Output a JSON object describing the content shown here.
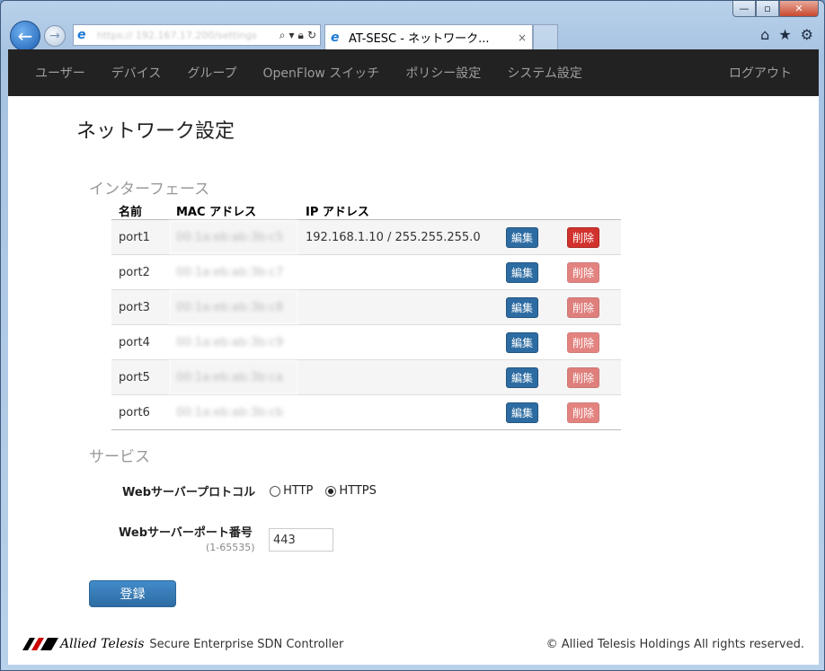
{
  "browser": {
    "address_text": "https://  192.167.17.200/settings",
    "tab_title": "AT-SESC - ネットワーク...",
    "tab_close": "×",
    "window_controls": {
      "minimize": "—",
      "maximize": "▫",
      "close": "✕"
    }
  },
  "navbar": {
    "items": [
      "ユーザー",
      "デバイス",
      "グループ",
      "OpenFlow スイッチ",
      "ポリシー設定",
      "システム設定"
    ],
    "logout": "ログアウト"
  },
  "page": {
    "title": "ネットワーク設定"
  },
  "interfaces": {
    "heading": "インターフェース",
    "columns": {
      "name": "名前",
      "mac": "MAC アドレス",
      "ip": "IP アドレス"
    },
    "edit_label": "編集",
    "delete_label": "削除",
    "rows": [
      {
        "name": "port1",
        "mac": "00:1a:eb:ab:3b:c5",
        "ip": "192.168.1.10 / 255.255.255.0"
      },
      {
        "name": "port2",
        "mac": "00:1a:eb:ab:3b:c7",
        "ip": ""
      },
      {
        "name": "port3",
        "mac": "00:1a:eb:ab:3b:c8",
        "ip": ""
      },
      {
        "name": "port4",
        "mac": "00:1a:eb:ab:3b:c9",
        "ip": ""
      },
      {
        "name": "port5",
        "mac": "00:1a:eb:ab:3b:ca",
        "ip": ""
      },
      {
        "name": "port6",
        "mac": "00:1a:eb:ab:3b:cb",
        "ip": ""
      }
    ]
  },
  "service": {
    "heading": "サービス",
    "protocol_label": "Webサーバープロトコル",
    "protocol_options": [
      "HTTP",
      "HTTPS"
    ],
    "protocol_selected": "HTTPS",
    "port_label": "Webサーバーポート番号",
    "port_hint": "(1-65535)",
    "port_value": "443"
  },
  "submit_label": "登録",
  "footer": {
    "logo_text": "Allied Telesis",
    "product": "Secure Enterprise SDN Controller",
    "copyright": "© Allied Telesis Holdings All rights reserved."
  }
}
